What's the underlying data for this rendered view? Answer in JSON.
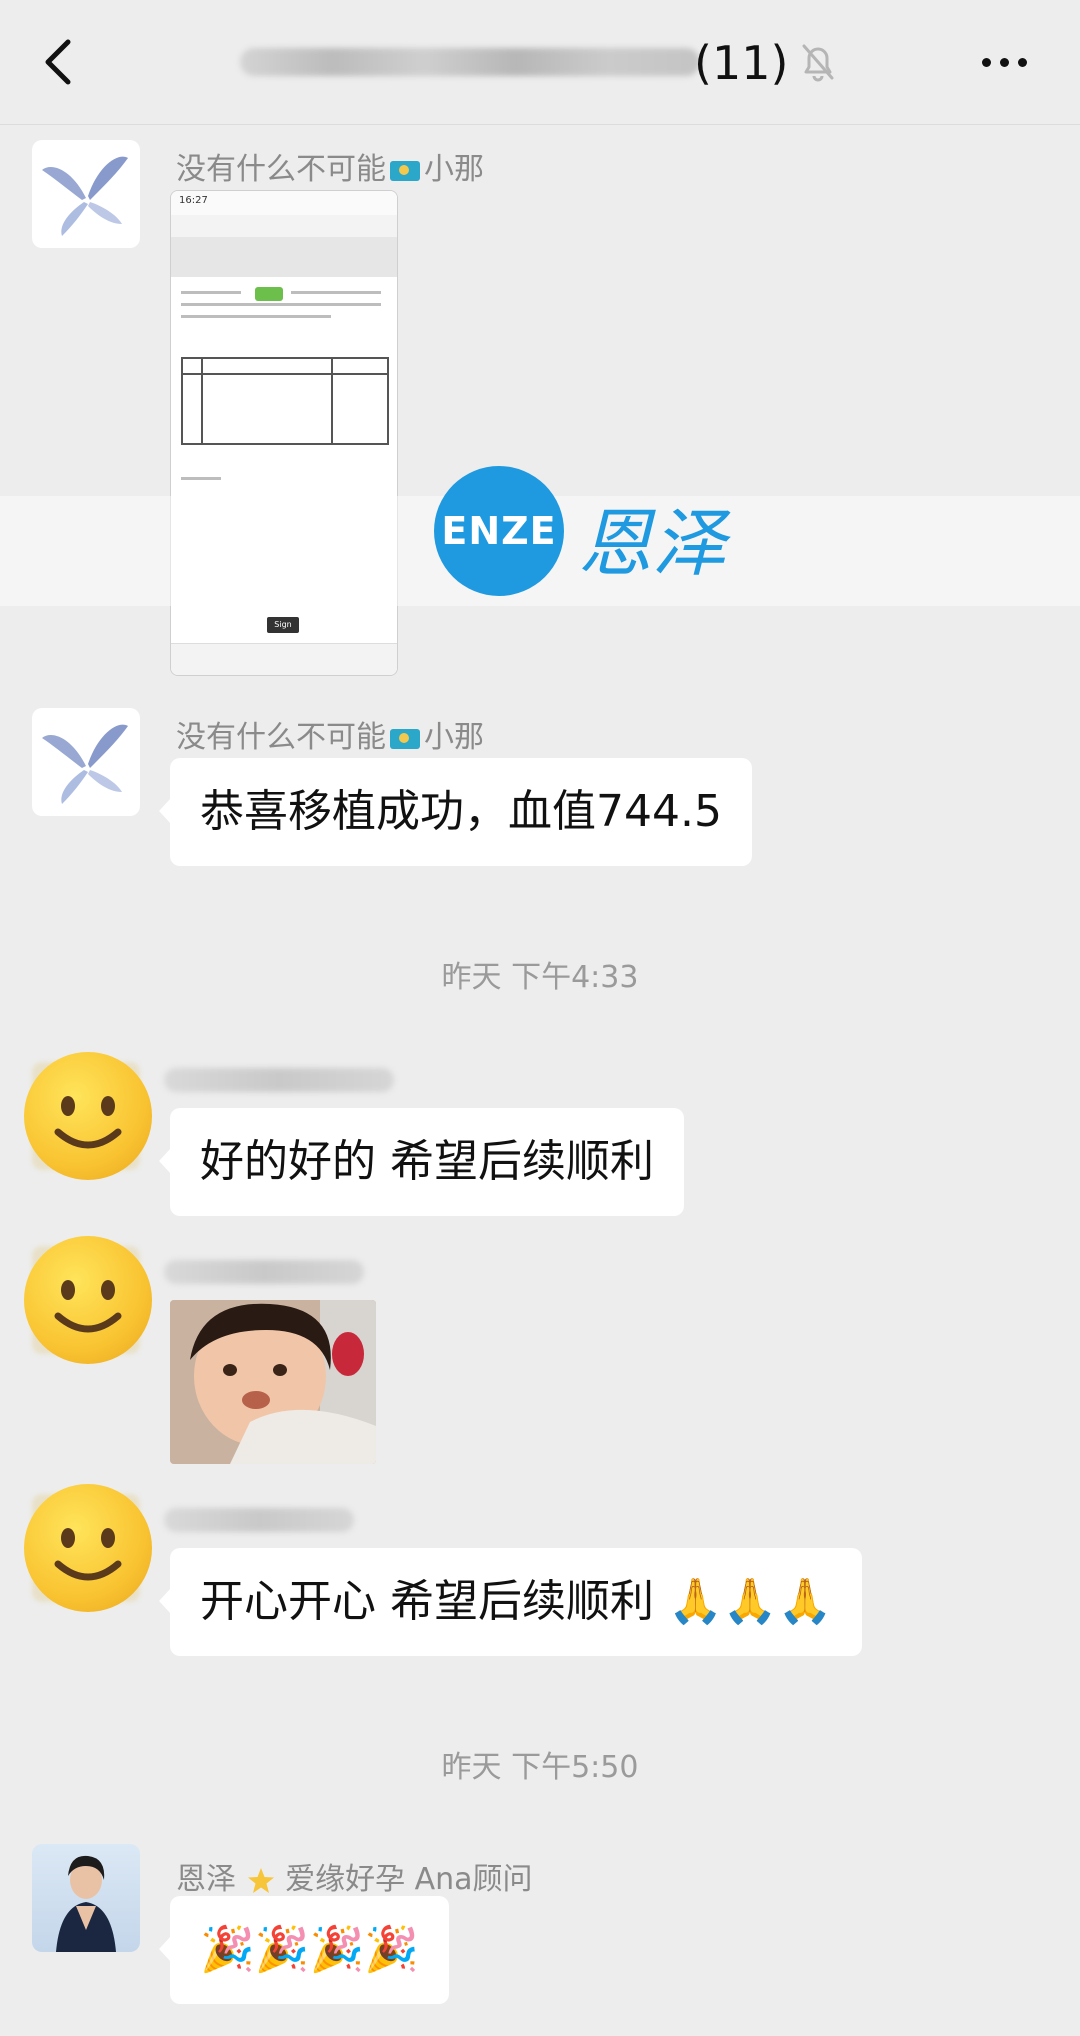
{
  "header": {
    "member_count": "(11)"
  },
  "messages": {
    "m1": {
      "sender": "没有什么不可能",
      "sender_suffix": "小那"
    },
    "m2": {
      "sender": "没有什么不可能",
      "sender_suffix": "小那",
      "text": "恭喜移植成功，血值744.5"
    },
    "ts1": "昨天 下午4:33",
    "m3": {
      "text": "好的好的 希望后续顺利"
    },
    "m5": {
      "text": "开心开心 希望后续顺利 🙏🙏🙏"
    },
    "ts2": "昨天 下午5:50",
    "m6": {
      "sender": "恩泽",
      "sender_suffix": "爱缘好孕 Ana顾问",
      "text": "🎉🎉🎉🎉"
    }
  },
  "watermark": {
    "logo_text": "ENZE",
    "brand_text": "恩泽"
  },
  "shot": {
    "status_time": "16:27",
    "button_label": "Sign"
  },
  "colors": {
    "background": "#ededed",
    "bubble": "#ffffff",
    "watermark_blue": "#1f9ae0"
  },
  "icons": [
    "back-chevron-icon",
    "bell-muted-icon",
    "more-dots-icon",
    "flag-kazakhstan-icon",
    "star-icon",
    "smiley-avatar-icon"
  ]
}
